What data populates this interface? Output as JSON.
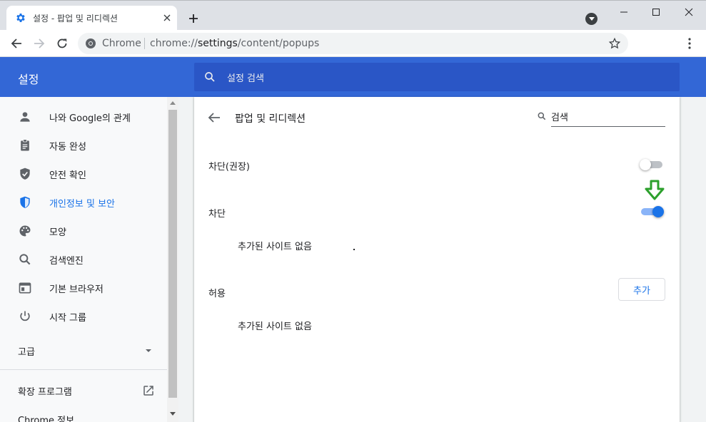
{
  "browser": {
    "tab_title": "설정 - 팝업 및 리디렉션",
    "omnibox_site": "Chrome",
    "omnibox_url_scheme": "chrome://",
    "omnibox_url_host": "settings",
    "omnibox_url_path": "/content/popups"
  },
  "header": {
    "title": "설정",
    "search_placeholder": "설정 검색"
  },
  "sidebar": {
    "items": [
      {
        "label": "나와 Google의 관계",
        "icon": "person-icon",
        "active": false
      },
      {
        "label": "자동 완성",
        "icon": "clipboard-icon",
        "active": false
      },
      {
        "label": "안전 확인",
        "icon": "shield-check-icon",
        "active": false
      },
      {
        "label": "개인정보 및 보안",
        "icon": "shield-icon",
        "active": true
      },
      {
        "label": "모양",
        "icon": "palette-icon",
        "active": false
      },
      {
        "label": "검색엔진",
        "icon": "search-icon",
        "active": false
      },
      {
        "label": "기본 브라우저",
        "icon": "browser-icon",
        "active": false
      },
      {
        "label": "시작 그룹",
        "icon": "power-icon",
        "active": false
      }
    ],
    "advanced_label": "고급",
    "extensions_label": "확장 프로그램",
    "about_label": "Chrome 정보"
  },
  "content": {
    "page_title": "팝업 및 리디렉션",
    "search_placeholder": "검색",
    "blocked_recommended_label": "차단(권장)",
    "blocked_recommended_on": false,
    "block_label": "차단",
    "block_on": true,
    "block_empty": "추가된 사이트 없음",
    "allow_label": "허용",
    "add_button": "추가",
    "allow_empty": "추가된 사이트 없음"
  },
  "colors": {
    "accent": "#1a73e8",
    "header_blue": "#3367d6",
    "annotation_green": "#2ca02c"
  }
}
